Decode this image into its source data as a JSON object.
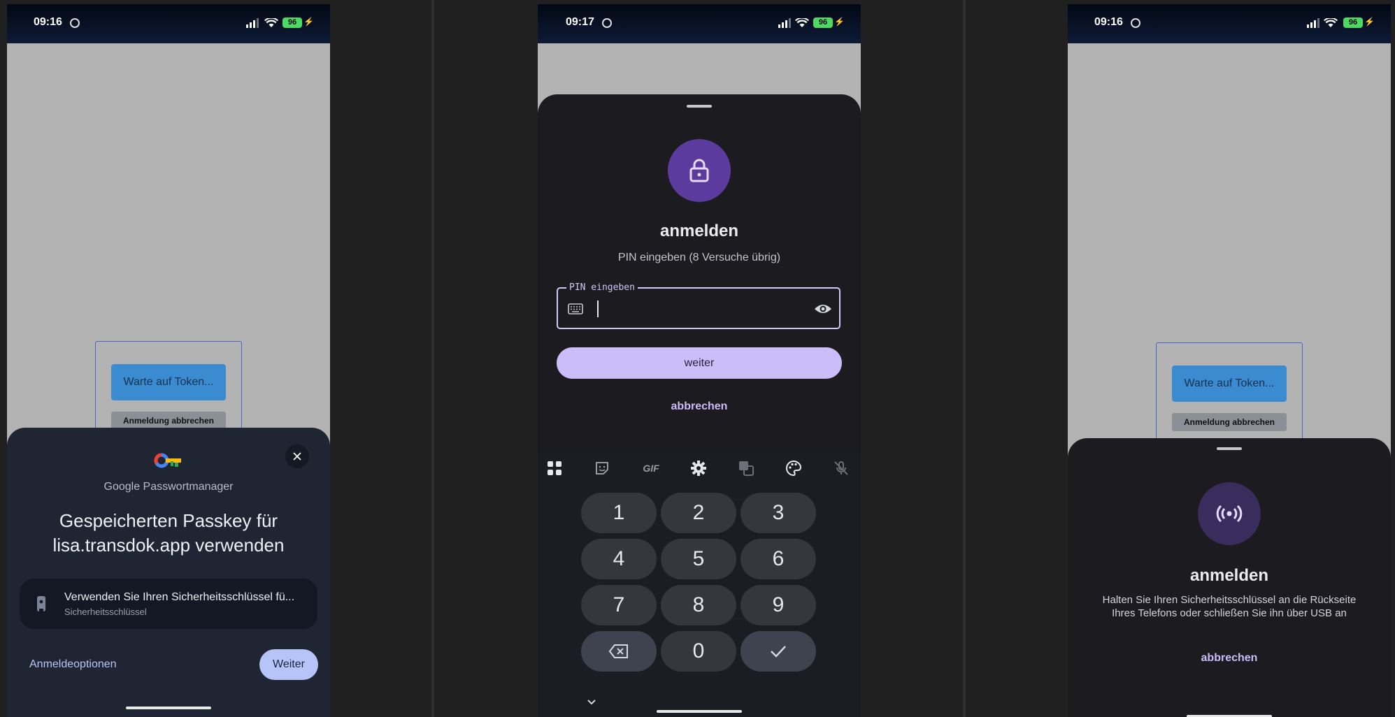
{
  "screen1": {
    "time": "09:16",
    "battery": "96",
    "web": {
      "token_button": "Warte auf Token...",
      "cancel_button": "Anmeldung abbrechen"
    },
    "sheet": {
      "app_name": "Google Passwortmanager",
      "title_line1": "Gespeicherten Passkey für",
      "title_line2": "lisa.transdok.app verwenden",
      "option_title": "Verwenden Sie Ihren Sicherheitsschlüssel fü...",
      "option_subtitle": "Sicherheitsschlüssel",
      "sign_in_options": "Anmeldeoptionen",
      "continue_button": "Weiter"
    }
  },
  "screen2": {
    "time": "09:17",
    "battery": "96",
    "title": "anmelden",
    "subtitle": "PIN eingeben (8 Versuche übrig)",
    "pin_label": "PIN eingeben",
    "continue_button": "weiter",
    "cancel_link": "abbrechen",
    "toolbar_gif": "GIF",
    "keys": [
      "1",
      "2",
      "3",
      "4",
      "5",
      "6",
      "7",
      "8",
      "9",
      "0"
    ]
  },
  "screen3": {
    "time": "09:16",
    "battery": "96",
    "web": {
      "token_button": "Warte auf Token...",
      "cancel_button": "Anmeldung abbrechen"
    },
    "title": "anmelden",
    "message_line1": "Halten Sie Ihren Sicherheitsschlüssel an die Rückseite",
    "message_line2": "Ihres Telefons oder schließen Sie ihn über USB an",
    "cancel_link": "abbrechen"
  },
  "colors": {
    "accent_purple": "#cbbdf9",
    "icon_purple": "#5b3c9e",
    "sheet_dark": "#1c1b20"
  }
}
